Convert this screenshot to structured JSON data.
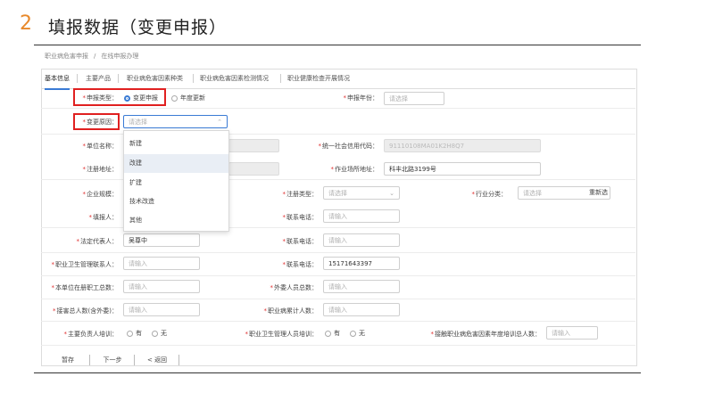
{
  "heading": {
    "step": "2",
    "title": "填报数据（变更申报）"
  },
  "breadcrumb": [
    "职业病危害申报",
    "在线申报办理"
  ],
  "tabs": [
    "基本信息",
    "主要产品",
    "职业病危害因素种类",
    "职业病危害因素检测情况",
    "职业健康检查开展情况"
  ],
  "form": {
    "apply_type": {
      "label": "申报类型：",
      "options": [
        "变更申报",
        "年度更新"
      ],
      "selected": "变更申报"
    },
    "apply_year": {
      "label": "申报年份：",
      "placeholder": "请选择"
    },
    "change_reason": {
      "label": "变更原因：",
      "placeholder": "请选择"
    },
    "unit_name": {
      "label": "单位名称："
    },
    "credit_code": {
      "label": "统一社会信用代码：",
      "value": "91110108MA01K2H8Q7"
    },
    "reg_address": {
      "label": "注册地址："
    },
    "work_address": {
      "label": "作业场所地址：",
      "value": "科丰北路3199号"
    },
    "enterprise_scale": {
      "label": "企业规模："
    },
    "reg_type": {
      "label": "注册类型：",
      "placeholder": "请选择"
    },
    "industry": {
      "label": "行业分类：",
      "placeholder": "请选择",
      "action": "重新选"
    },
    "filler": {
      "label": "填报人：",
      "placeholder": ""
    },
    "contact_phone": {
      "label": "联系电话：",
      "placeholder": "请输入"
    },
    "legal_rep": {
      "label": "法定代表人：",
      "value": "吴尊中"
    },
    "legal_phone": {
      "label": "联系电话：",
      "placeholder": "请输入"
    },
    "health_manager": {
      "label": "职业卫生管理联系人：",
      "placeholder": "请输入"
    },
    "manager_phone": {
      "label": "联系电话：",
      "value": "15171643397"
    },
    "employees": {
      "label": "本单位在册职工总数：",
      "placeholder": "请输入"
    },
    "outsourced": {
      "label": "外委人员总数：",
      "placeholder": "请输入"
    },
    "exposed_total": {
      "label": "接害总人数(含外委)：",
      "placeholder": "请输入"
    },
    "disease_total": {
      "label": "职业病累计人数：",
      "placeholder": "请输入"
    },
    "lead_trained": {
      "label": "主要负责人培训：",
      "yes": "有",
      "no": "无"
    },
    "mgr_trained": {
      "label": "职业卫生管理人员培训：",
      "yes": "有",
      "no": "无"
    },
    "worker_trained": {
      "label": "接触职业病危害因素年度培训总人数：",
      "placeholder": "请输入"
    }
  },
  "dropdown": {
    "items": [
      "新建",
      "改建",
      "扩建",
      "技术改造",
      "其他"
    ],
    "highlighted": "改建"
  },
  "footer": {
    "save": "暂存",
    "next": "下一步",
    "back": "< 返回"
  },
  "colors": {
    "accent": "#e8892b",
    "highlight": "#e02020",
    "primary": "#3a7bd5"
  }
}
